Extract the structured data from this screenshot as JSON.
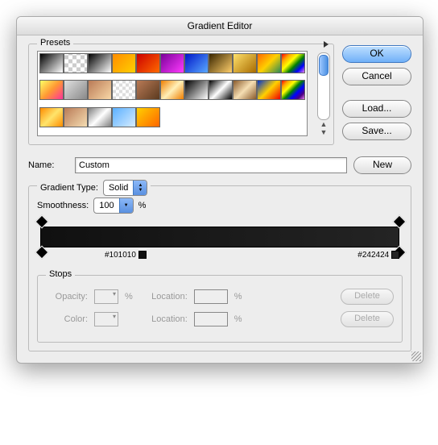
{
  "title": "Gradient Editor",
  "presets": {
    "legend": "Presets",
    "swatches": [
      "linear-gradient(135deg,#000,#fff)",
      "repeating-conic-gradient(#ccc 0 25%,#fff 0 50%) 0/10px 10px",
      "linear-gradient(135deg,#000,#fff)",
      "linear-gradient(135deg,#ff8c00,#ffd000)",
      "linear-gradient(135deg,#c00,#ff6a00)",
      "linear-gradient(135deg,#7a0099,#ff3cff)",
      "linear-gradient(135deg,#0017c8,#5aa8ff)",
      "linear-gradient(135deg,#3a2600,#ffcf6b)",
      "linear-gradient(135deg,#ffe16b,#a86b00)",
      "linear-gradient(135deg,#ff6a00,#ffd000,#2e8b57)",
      "linear-gradient(135deg,red,orange,yellow,green,blue,violet)",
      "linear-gradient(135deg,#ff6,#f93,#f39)",
      "linear-gradient(135deg,#e0e0e0,#888)",
      "linear-gradient(135deg,#b97a56,#f9d8a7)",
      "repeating-conic-gradient(#ddd 0 25%,#fff 0 50%) 0/8px 8px",
      "linear-gradient(135deg,#b97a56,#5b3a1f)",
      "linear-gradient(135deg,#ef7f00,#fff0b8,#ef7f00)",
      "linear-gradient(135deg,#000,#fff)",
      "linear-gradient(135deg,#000,#fff,#000)",
      "linear-gradient(135deg,#8a5a2b,#f5deb3,#8a5a2b)",
      "linear-gradient(135deg,#0033cc,#ffd000,#e00)",
      "linear-gradient(135deg,red,orange,yellow,green,blue,indigo,violet)",
      "linear-gradient(135deg,#ff8c00,#ffe46b,#ff8c00)",
      "linear-gradient(135deg,#b97a56,#f5deb3)",
      "linear-gradient(135deg,#7f7f7f,#fff,#7f7f7f)",
      "linear-gradient(135deg,#5bb0ff,#d6ecff)",
      "linear-gradient(135deg,#ffd000,#ff6600)"
    ]
  },
  "buttons": {
    "ok": "OK",
    "cancel": "Cancel",
    "load": "Load...",
    "save": "Save...",
    "new": "New"
  },
  "nameRow": {
    "label": "Name:",
    "value": "Custom"
  },
  "gradient": {
    "typeLabel": "Gradient Type:",
    "typeValue": "Solid",
    "smoothLabel": "Smoothness:",
    "smoothValue": "100",
    "pct": "%",
    "stopLeft": "#101010",
    "stopRight": "#242424"
  },
  "stops": {
    "legend": "Stops",
    "opacityLabel": "Opacity:",
    "colorLabel": "Color:",
    "locationLabel": "Location:",
    "pct": "%",
    "delete": "Delete"
  }
}
